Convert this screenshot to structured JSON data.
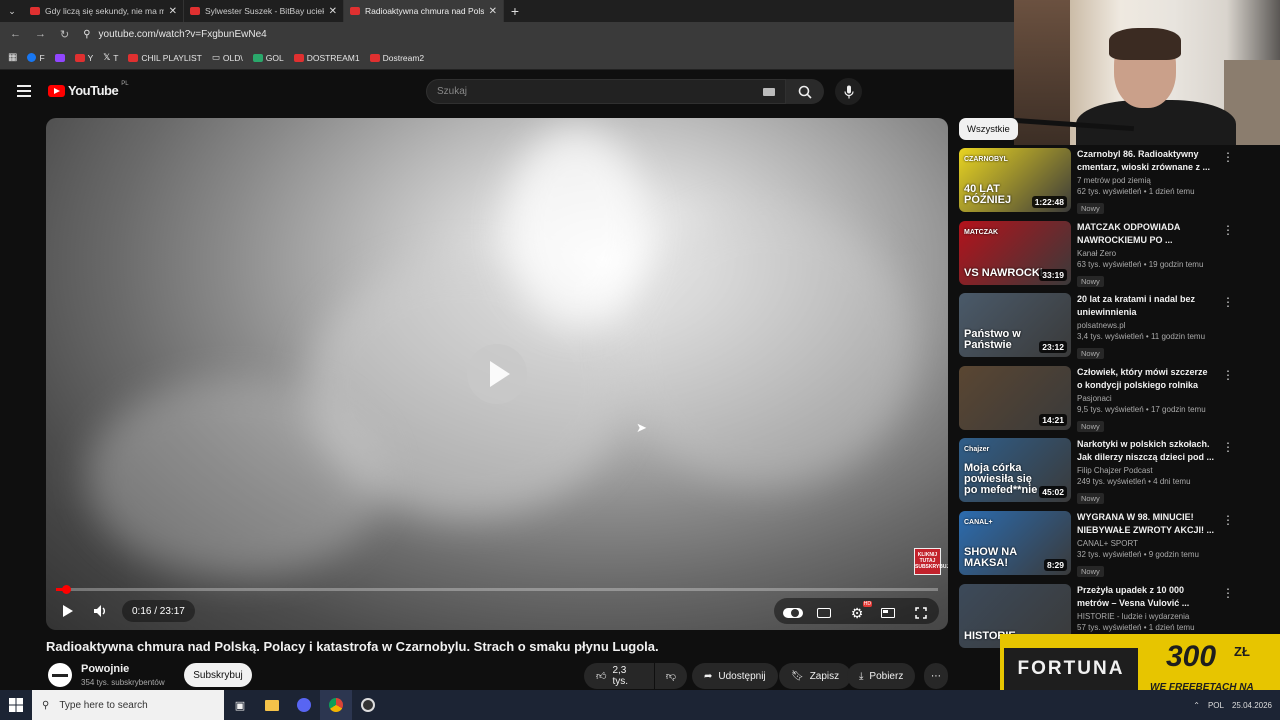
{
  "browser": {
    "tabs": [
      {
        "title": "Gdy liczą się sekundy, nie ma m"
      },
      {
        "title": "Sylwester Suszek - BitBay uciekł"
      },
      {
        "title": "Radioaktywna chmura nad Polsk"
      }
    ],
    "url": "youtube.com/watch?v=FxgbunEwNe4",
    "bookmarks": [
      "F",
      "Y",
      "T",
      "CHIL PLAYLIST",
      "OLD\\",
      "GOL",
      "DOSTREAM1",
      "Dostream2"
    ]
  },
  "youtube": {
    "logo": "YouTube",
    "country": "PL",
    "search_placeholder": "Szukaj"
  },
  "player": {
    "time": "0:16 / 23:17",
    "progress": 0.0115,
    "overlay_badge": "KLIKNIJ TUTAJ SUBSKRYBUJ"
  },
  "video": {
    "title": "Radioaktywna chmura nad Polską. Polacy i katastrofa w Czarnobylu. Strach o smaku płynu Lugola.",
    "channel": "Powojnie",
    "subscribers": "354 tys. subskrybentów",
    "subscribe_label": "Subskrybuj",
    "likes": "2,3 tys.",
    "share_label": "Udostępnij",
    "save_label": "Zapisz",
    "download_label": "Pobierz"
  },
  "sidebar": {
    "chip": "Wszystkie",
    "items": [
      {
        "title": "Czarnobyl 86. Radioaktywny cmentarz, wioski zrównane z ...",
        "channel": "7 metrów pod ziemią",
        "meta": "62 tys. wyświetleń • 1 dzień temu",
        "badge": "Nowy",
        "duration": "1:22:48",
        "thumb_text": "40 LAT PÓŹNIEJ",
        "thumb_top": "CZARNOBYL",
        "color": "#e9d421"
      },
      {
        "title": "MATCZAK ODPOWIADA NAWROCKIEMU PO ...",
        "channel": "Kanał Zero",
        "meta": "63 tys. wyświetleń • 19 godzin temu",
        "badge": "Nowy",
        "duration": "33:19",
        "thumb_text": "VS NAWROCKI",
        "thumb_top": "MATCZAK",
        "color": "#b3121b"
      },
      {
        "title": "20 lat za kratami i nadal bez uniewinnienia",
        "channel": "polsatnews.pl",
        "meta": "3,4 tys. wyświetleń • 11 godzin temu",
        "badge": "Nowy",
        "duration": "23:12",
        "thumb_text": "Państwo w Państwie",
        "thumb_top": "",
        "color": "#4a5a6a"
      },
      {
        "title": "Człowiek, który mówi szczerze o kondycji polskiego rolnika",
        "channel": "Pasjonaci",
        "meta": "9,5 tys. wyświetleń • 17 godzin temu",
        "badge": "Nowy",
        "duration": "14:21",
        "thumb_text": "",
        "thumb_top": "",
        "color": "#5a4632"
      },
      {
        "title": "Narkotyki w polskich szkołach. Jak dilerzy niszczą dzieci pod ...",
        "channel": "Filip Chajzer Podcast",
        "meta": "249 tys. wyświetleń • 4 dni temu",
        "badge": "Nowy",
        "duration": "45:02",
        "thumb_text": "Moja córka powiesiła się po mefed**nie",
        "thumb_top": "Chajzer",
        "color": "#2f5e8a"
      },
      {
        "title": "WYGRANA W 98. MINUCIE! NIEBYWAŁE ZWROTY AKCJI! ...",
        "channel": "CANAL+ SPORT",
        "meta": "32 tys. wyświetleń • 9 godzin temu",
        "badge": "Nowy",
        "duration": "8:29",
        "thumb_text": "SHOW NA MAKSA!",
        "thumb_top": "CANAL+",
        "color": "#2b6cb0"
      },
      {
        "title": "Przeżyła upadek z 10 000 metrów – Vesna Vulović ...",
        "channel": "HISTORIE - ludzie i wydarzenia",
        "meta": "57 tys. wyświetleń • 1 dzień temu",
        "badge": "",
        "duration": "",
        "thumb_text": "HISTORIE",
        "thumb_top": "",
        "color": "#3c4a5a"
      }
    ]
  },
  "ad": {
    "brand": "FORTUNA",
    "amount": "300",
    "currency": "ZŁ",
    "text": "WE FREEBETACH NA START"
  },
  "taskbar": {
    "search_placeholder": "Type here to search",
    "lang": "POL",
    "date": "25.04.2026"
  }
}
